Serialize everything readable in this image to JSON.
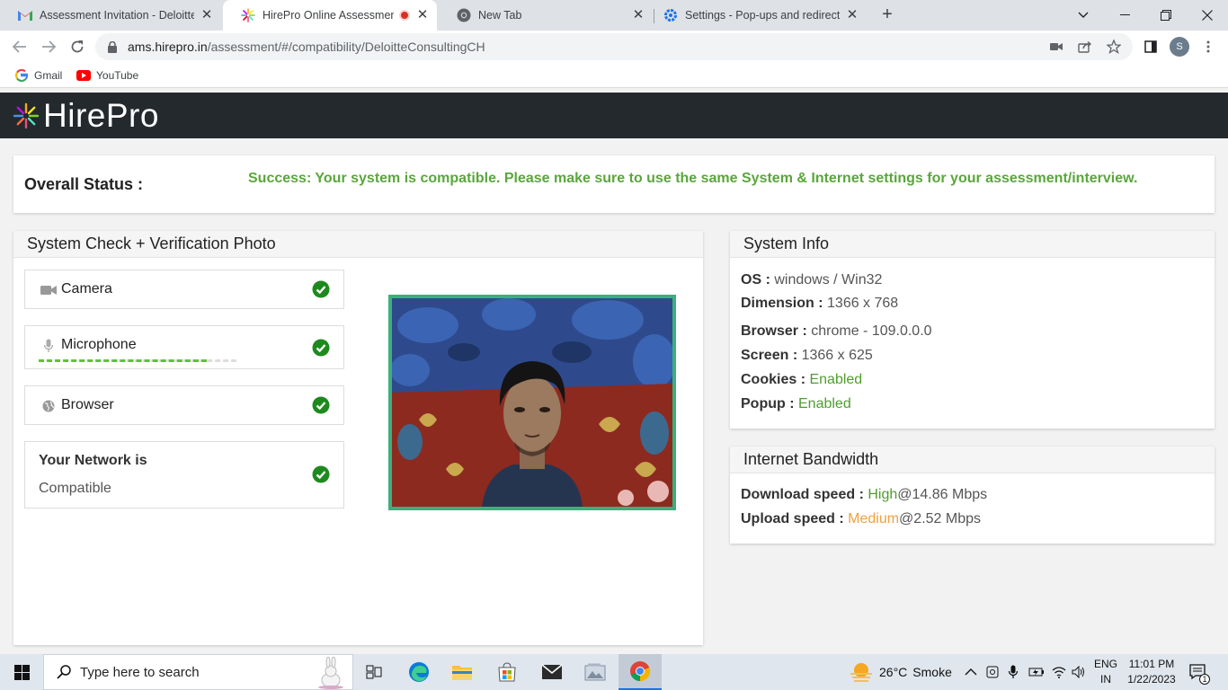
{
  "browser": {
    "tabs": [
      {
        "title": "Assessment Invitation - Deloitte C",
        "favicon": "gmail-icon"
      },
      {
        "title": "HirePro Online Assessment",
        "favicon": "hirepro-icon",
        "recording": true
      },
      {
        "title": "New Tab",
        "favicon": "chrome-icon"
      },
      {
        "title": "Settings - Pop-ups and redirects",
        "favicon": "settings-gear-icon"
      }
    ],
    "url_host": "ams.hirepro.in",
    "url_path": "/assessment/#/compatibility/DeloitteConsultingCH",
    "profile_initial": "S",
    "bookmarks": [
      {
        "label": "Gmail",
        "icon": "google-icon"
      },
      {
        "label": "YouTube",
        "icon": "youtube-icon"
      }
    ]
  },
  "brand": {
    "name": "HirePro"
  },
  "overall_status": {
    "label": "Overall Status :",
    "message": "Success: Your system is compatible. Please make sure to use the same System & Internet settings for your assessment/interview."
  },
  "system_check": {
    "title": "System Check + Verification Photo",
    "items": [
      {
        "label": "Camera",
        "icon": "video-camera-icon",
        "status": "ok"
      },
      {
        "label": "Microphone",
        "icon": "microphone-icon",
        "status": "ok",
        "level": 0.85
      },
      {
        "label": "Browser",
        "icon": "globe-icon",
        "status": "ok"
      }
    ],
    "network": {
      "title": "Your Network is",
      "value": "Compatible",
      "status": "ok"
    }
  },
  "system_info": {
    "title": "System Info",
    "rows": [
      {
        "label": "OS :",
        "value": "windows / Win32"
      },
      {
        "label": "Dimension :",
        "value": "1366 x 768"
      },
      {
        "label": "Browser :",
        "value": "chrome - 109.0.0.0"
      },
      {
        "label": "Screen :",
        "value": "1366 x 625"
      },
      {
        "label": "Cookies :",
        "value": "Enabled"
      },
      {
        "label": "Popup :",
        "value": "Enabled"
      }
    ]
  },
  "bandwidth": {
    "title": "Internet Bandwidth",
    "download": {
      "label": "Download speed :",
      "level": "High",
      "value": "@14.86 Mbps"
    },
    "upload": {
      "label": "Upload speed :",
      "level": "Medium",
      "value": "@2.52 Mbps"
    }
  },
  "colors": {
    "success": "#5aa63c",
    "brand_bar": "#24292e",
    "photo_border": "#3bb07b",
    "medium": "#f0a040"
  },
  "taskbar": {
    "search_placeholder": "Type here to search",
    "weather": {
      "temp": "26°C",
      "condition": "Smoke"
    },
    "lang": {
      "line1": "ENG",
      "line2": "IN"
    },
    "time": "11:01 PM",
    "date": "1/22/2023",
    "notifications": "1"
  }
}
